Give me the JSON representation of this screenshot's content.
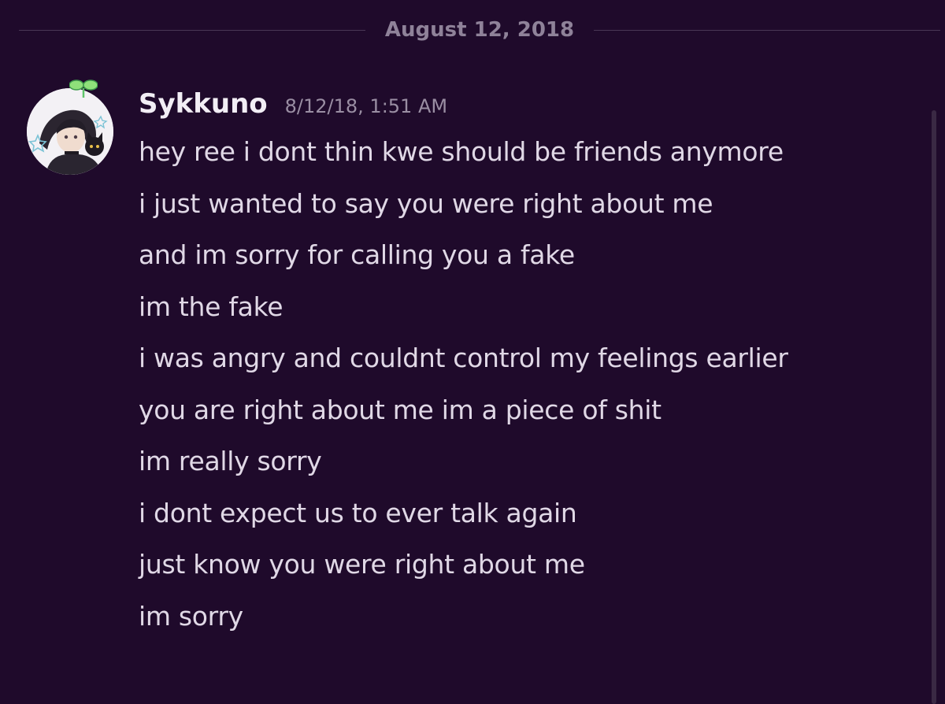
{
  "divider": {
    "date": "August 12, 2018"
  },
  "message_group": {
    "username": "Sykkuno",
    "timestamp": "8/12/18, 1:51 AM",
    "avatar_icon": "anime-avatar-with-sprout",
    "lines": [
      "hey ree i dont thin kwe should be friends anymore",
      "i just wanted to say you were right about me",
      "and im sorry for calling you a fake",
      "im the fake",
      "i was angry and couldnt control my feelings earlier",
      "you are right about me im a piece of shit",
      "im really sorry",
      "i dont expect us to ever talk again",
      "just know you were right about me",
      "im sorry"
    ]
  },
  "colors": {
    "background": "#1f0a2b",
    "text": "#e0d8e6",
    "muted": "#9a8ea3"
  }
}
